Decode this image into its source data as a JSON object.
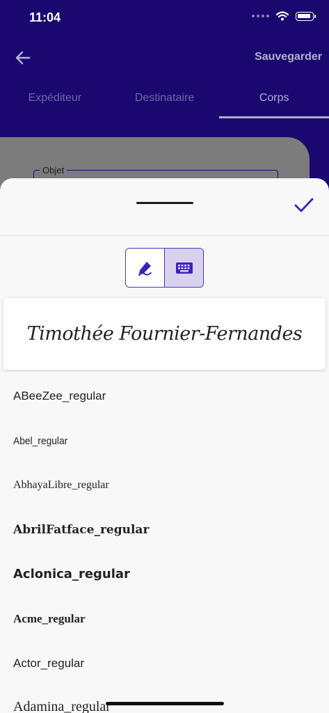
{
  "status_bar": {
    "time": "11:04"
  },
  "header": {
    "save_label": "Sauvegarder"
  },
  "tabs": [
    {
      "label": "Expéditeur",
      "active": false
    },
    {
      "label": "Destinataire",
      "active": false
    },
    {
      "label": "Corps",
      "active": true
    }
  ],
  "form": {
    "subject_label": "Objet"
  },
  "signature_sheet": {
    "mode": "keyboard",
    "preview_text": "Timothée Fournier-Fernandes",
    "fonts": [
      "ABeeZee_regular",
      "Abel_regular",
      "AbhayaLibre_regular",
      "AbrilFatface_regular",
      "Aclonica_regular",
      "Acme_regular",
      "Actor_regular",
      "Adamina_regular"
    ]
  },
  "colors": {
    "primary": "#1a0870",
    "accent": "#3d22b8",
    "toggle_active_bg": "#d8d2ee"
  }
}
